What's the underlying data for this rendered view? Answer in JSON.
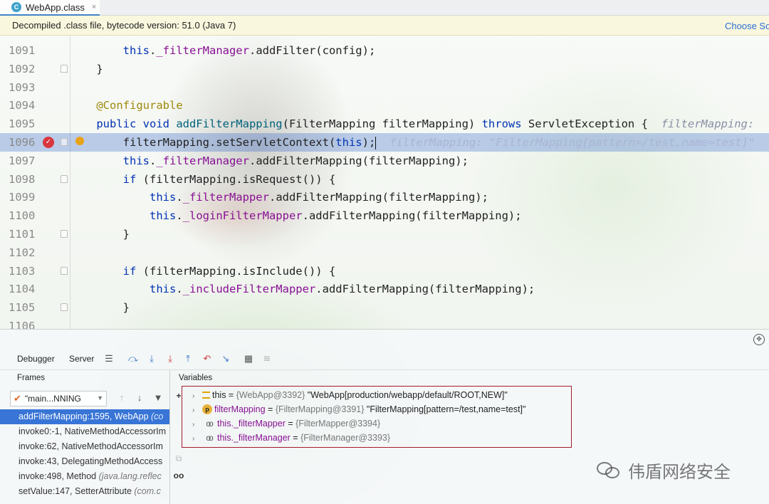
{
  "tab": {
    "file_name": "WebApp.class",
    "icon": "class-file-icon",
    "close": "×"
  },
  "banner": {
    "message": "Decompiled .class file, bytecode version: 51.0 (Java 7)",
    "action_label": "Choose So"
  },
  "editor": {
    "lines": [
      {
        "num": "1091",
        "parts": [
          [
            "",
            "        "
          ],
          [
            "kw",
            "this"
          ],
          [
            "",
            "."
          ],
          [
            "fld",
            "_filterManager"
          ],
          [
            "",
            ".addFilter(config);"
          ]
        ]
      },
      {
        "num": "1092",
        "parts": [
          [
            "",
            "    }"
          ]
        ]
      },
      {
        "num": "1093",
        "parts": []
      },
      {
        "num": "1094",
        "parts": [
          [
            "",
            "    "
          ],
          [
            "ann",
            "@Configurable"
          ]
        ]
      },
      {
        "num": "1095",
        "parts": [
          [
            "",
            "    "
          ],
          [
            "kw",
            "public void "
          ],
          [
            "mth",
            "addFilterMapping"
          ],
          [
            "",
            "(FilterMapping filterMapping) "
          ],
          [
            "kw",
            "throws"
          ],
          [
            "",
            " ServletException {  "
          ],
          [
            "hint",
            "filterMapping: "
          ]
        ]
      },
      {
        "num": "1096",
        "parts": [
          [
            "",
            "        filterMapping.setServletContext("
          ],
          [
            "kw",
            "this"
          ],
          [
            "",
            ");"
          ],
          [
            "caret",
            ""
          ],
          [
            "hint-cur",
            "  filterMapping: \"FilterMapping[pattern=/test,name=test]\""
          ]
        ]
      },
      {
        "num": "1097",
        "parts": [
          [
            "",
            "        "
          ],
          [
            "kw",
            "this"
          ],
          [
            "",
            "."
          ],
          [
            "fld",
            "_filterManager"
          ],
          [
            "",
            ".addFilterMapping(filterMapping);"
          ]
        ]
      },
      {
        "num": "1098",
        "parts": [
          [
            "",
            "        "
          ],
          [
            "kw",
            "if"
          ],
          [
            "",
            " (filterMapping.isRequest()) {"
          ]
        ]
      },
      {
        "num": "1099",
        "parts": [
          [
            "",
            "            "
          ],
          [
            "kw",
            "this"
          ],
          [
            "",
            "."
          ],
          [
            "fld",
            "_filterMapper"
          ],
          [
            "",
            ".addFilterMapping(filterMapping);"
          ]
        ]
      },
      {
        "num": "1100",
        "parts": [
          [
            "",
            "            "
          ],
          [
            "kw",
            "this"
          ],
          [
            "",
            "."
          ],
          [
            "fld",
            "_loginFilterMapper"
          ],
          [
            "",
            ".addFilterMapping(filterMapping);"
          ]
        ]
      },
      {
        "num": "1101",
        "parts": [
          [
            "",
            "        }"
          ]
        ]
      },
      {
        "num": "1102",
        "parts": []
      },
      {
        "num": "1103",
        "parts": [
          [
            "",
            "        "
          ],
          [
            "kw",
            "if"
          ],
          [
            "",
            " (filterMapping.isInclude()) {"
          ]
        ]
      },
      {
        "num": "1104",
        "parts": [
          [
            "",
            "            "
          ],
          [
            "kw",
            "this"
          ],
          [
            "",
            "."
          ],
          [
            "fld",
            "_includeFilterMapper"
          ],
          [
            "",
            ".addFilterMapping(filterMapping);"
          ]
        ]
      },
      {
        "num": "1105",
        "parts": [
          [
            "",
            "        }"
          ]
        ]
      },
      {
        "num": "1106",
        "parts": []
      }
    ],
    "current_line": "1096"
  },
  "debugger": {
    "tabs": {
      "debugger": "Debugger",
      "server": "Server"
    },
    "frames_header": "Frames",
    "variables_header": "Variables",
    "thread": "\"main...NNING",
    "frames": [
      {
        "method": "addFilterMapping:1595, WebApp ",
        "pkg": "(co",
        "selected": true
      },
      {
        "method": "invoke0:-1, NativeMethodAccessorIm",
        "pkg": "",
        "selected": false
      },
      {
        "method": "invoke:62, NativeMethodAccessorIm",
        "pkg": "",
        "selected": false
      },
      {
        "method": "invoke:43, DelegatingMethodAccess",
        "pkg": "",
        "selected": false
      },
      {
        "method": "invoke:498, Method ",
        "pkg": "(java.lang.reflec",
        "selected": false
      },
      {
        "method": "setValue:147, SetterAttribute ",
        "pkg": "(com.c",
        "selected": false
      }
    ],
    "variables": [
      {
        "icon": "list",
        "name": "this",
        "type": "{WebApp@3392}",
        "value": "\"WebApp[production/webapp/default/ROOT,NEW]\""
      },
      {
        "icon": "param",
        "name": "filterMapping",
        "type": "{FilterMapping@3391}",
        "value": "\"FilterMapping[pattern=/test,name=test]\""
      },
      {
        "icon": "field",
        "name": "this._filterMapper",
        "type": "{FilterMapper@3394}",
        "value": ""
      },
      {
        "icon": "field",
        "name": "this._filterManager",
        "type": "{FilterManager@3393}",
        "value": ""
      }
    ]
  },
  "watermark": {
    "text": "伟盾网络安全"
  },
  "colors": {
    "keyword": "#0033b3",
    "field": "#871094",
    "annotation": "#9e880d",
    "selection": "#3875d6",
    "highlight_box": "#a51c2c"
  }
}
